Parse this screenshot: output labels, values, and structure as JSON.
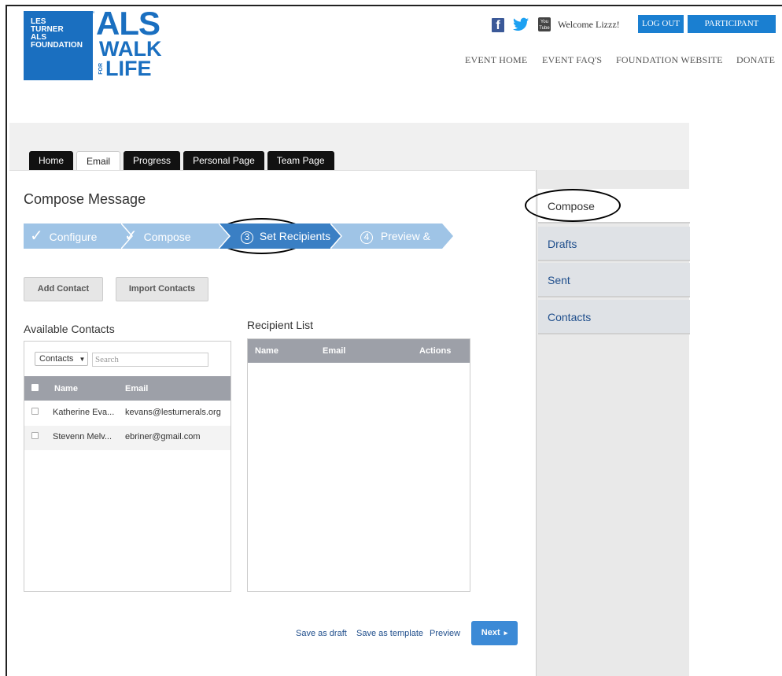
{
  "logo": {
    "org_line1": "LES",
    "org_line2": "TURNER",
    "org_line3": "ALS",
    "org_line4": "FOUNDATION",
    "registered": "™",
    "als": "ALS",
    "walk": "WALK",
    "for": "FOR",
    "life": "LIFE"
  },
  "header": {
    "welcome": "Welcome Lizzz!",
    "logout_label": "LOG OUT",
    "participant_center_label": "PARTICIPANT CENTER",
    "nav": [
      "EVENT HOME",
      "EVENT FAQ'S",
      "FOUNDATION WEBSITE",
      "DONATE"
    ],
    "social": {
      "facebook": "f",
      "youtube_top": "You",
      "youtube_bottom": "Tube"
    }
  },
  "tabs": [
    {
      "label": "Home",
      "active": false
    },
    {
      "label": "Email",
      "active": true
    },
    {
      "label": "Progress",
      "active": false
    },
    {
      "label": "Personal Page",
      "active": false
    },
    {
      "label": "Team Page",
      "active": false
    }
  ],
  "main": {
    "title": "Compose Message",
    "wizard": {
      "steps": [
        {
          "mark": "✓",
          "label": "Configure",
          "state": "done"
        },
        {
          "mark": "✓",
          "label": "Compose",
          "state": "done"
        },
        {
          "mark": "3",
          "label": "Set Recipients",
          "state": "active"
        },
        {
          "mark": "4",
          "label": "Preview & Send",
          "state": "pending"
        }
      ]
    },
    "add_contact_label": "Add Contact",
    "import_contacts_label": "Import Contacts",
    "available": {
      "heading": "Available Contacts",
      "filter_value": "Contacts",
      "search_placeholder": "Search",
      "columns": [
        "Name",
        "Email"
      ],
      "rows": [
        {
          "name": "Katherine Eva...",
          "email": "kevans@lesturnerals.org"
        },
        {
          "name": "Stevenn Melv...",
          "email": "ebriner@gmail.com"
        }
      ]
    },
    "recipients": {
      "heading": "Recipient List",
      "columns": [
        "Name",
        "Email",
        "Actions"
      ]
    },
    "footer": {
      "save_draft": "Save as draft",
      "save_template": "Save as template",
      "preview": "Preview",
      "next": "Next"
    }
  },
  "sidebar": {
    "items": [
      "Compose",
      "Drafts",
      "Sent",
      "Contacts"
    ]
  },
  "colors": {
    "brand_blue": "#1a6fc0",
    "step_light": "#9fc4e6",
    "step_active": "#3a7fc4",
    "header_grey": "#9da0a8"
  }
}
